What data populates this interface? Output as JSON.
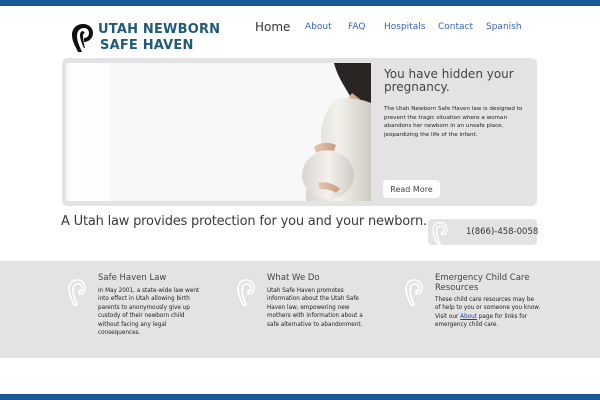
{
  "brand": {
    "line1": "UTAH NEWBORN",
    "line2": "SAFE HAVEN",
    "color": "#1f5a78"
  },
  "nav": {
    "items": [
      {
        "label": "Home",
        "active": true
      },
      {
        "label": "About"
      },
      {
        "label": "FAQ"
      },
      {
        "label": "Hospitals"
      },
      {
        "label": "Contact"
      },
      {
        "label": "Spanish"
      }
    ],
    "link_color": "#3a62b8"
  },
  "hero": {
    "title": "You have hidden your pregnancy.",
    "text": "The Utah Newborn Safe Haven law is designed to prevent the tragic situation where a woman abandons her newborn in an unsafe place, jeopardizing the life of the infant.",
    "button_label": "Read More"
  },
  "tagline": "A Utah law provides protection for you and your newborn.",
  "phone": {
    "number": "1(866)-458-0058",
    "icon": "safe-haven-hand-icon"
  },
  "features": [
    {
      "title": "Safe Haven Law",
      "text": "In May 2001, a state-wide law went into effect in Utah allowing birth parents to anonymously give up custody of their newborn child without facing any legal consequences.",
      "icon": "safe-haven-hand-icon"
    },
    {
      "title": "What We Do",
      "text": "Utah Safe Haven promotes information about the Utah Safe Haven law, empowering new mothers with information about a safe alternative to abandonment.",
      "icon": "safe-haven-hand-icon"
    },
    {
      "title": "Emergency Child Care Resources",
      "text_before": "These child care resources may be of help to you or someone you know. Visit our",
      "link_label": "About",
      "text_after": "page for links for emergency child care.",
      "icon": "safe-haven-hand-icon"
    }
  ],
  "colors": {
    "top_bar": "#1a5a96",
    "panel_gray": "#e3e3e3",
    "link_blue": "#1a3ec0"
  }
}
